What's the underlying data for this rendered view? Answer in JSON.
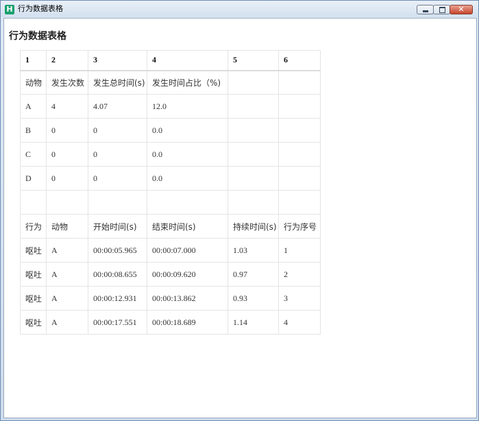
{
  "window": {
    "title": "行为数据表格",
    "icon_letter": "H",
    "icon": "app-h-icon",
    "buttons": {
      "minimize": "minimize-icon",
      "maximize": "maximize-icon",
      "close": "close-icon",
      "close_glyph": "✕"
    }
  },
  "page": {
    "title": "行为数据表格"
  },
  "table": {
    "header": [
      "1",
      "2",
      "3",
      "4",
      "5",
      "6"
    ],
    "rows": [
      [
        "动物",
        "发生次数",
        "发生总时间(s)",
        "发生时间占比（%)",
        "",
        ""
      ],
      [
        "A",
        "4",
        "4.07",
        "12.0",
        "",
        ""
      ],
      [
        "B",
        "0",
        "0",
        "0.0",
        "",
        ""
      ],
      [
        "C",
        "0",
        "0",
        "0.0",
        "",
        ""
      ],
      [
        "D",
        "0",
        "0",
        "0.0",
        "",
        ""
      ],
      [
        "",
        "",
        "",
        "",
        "",
        ""
      ],
      [
        "行为",
        "动物",
        "开始时间(s)",
        "结束时间(s)",
        "持续时间(s)",
        "行为序号"
      ],
      [
        "呕吐",
        "A",
        "00:00:05.965",
        "00:00:07.000",
        "1.03",
        "1"
      ],
      [
        "呕吐",
        "A",
        "00:00:08.655",
        "00:00:09.620",
        "0.97",
        "2"
      ],
      [
        "呕吐",
        "A",
        "00:00:12.931",
        "00:00:13.862",
        "0.93",
        "3"
      ],
      [
        "呕吐",
        "A",
        "00:00:17.551",
        "00:00:18.689",
        "1.14",
        "4"
      ]
    ]
  }
}
